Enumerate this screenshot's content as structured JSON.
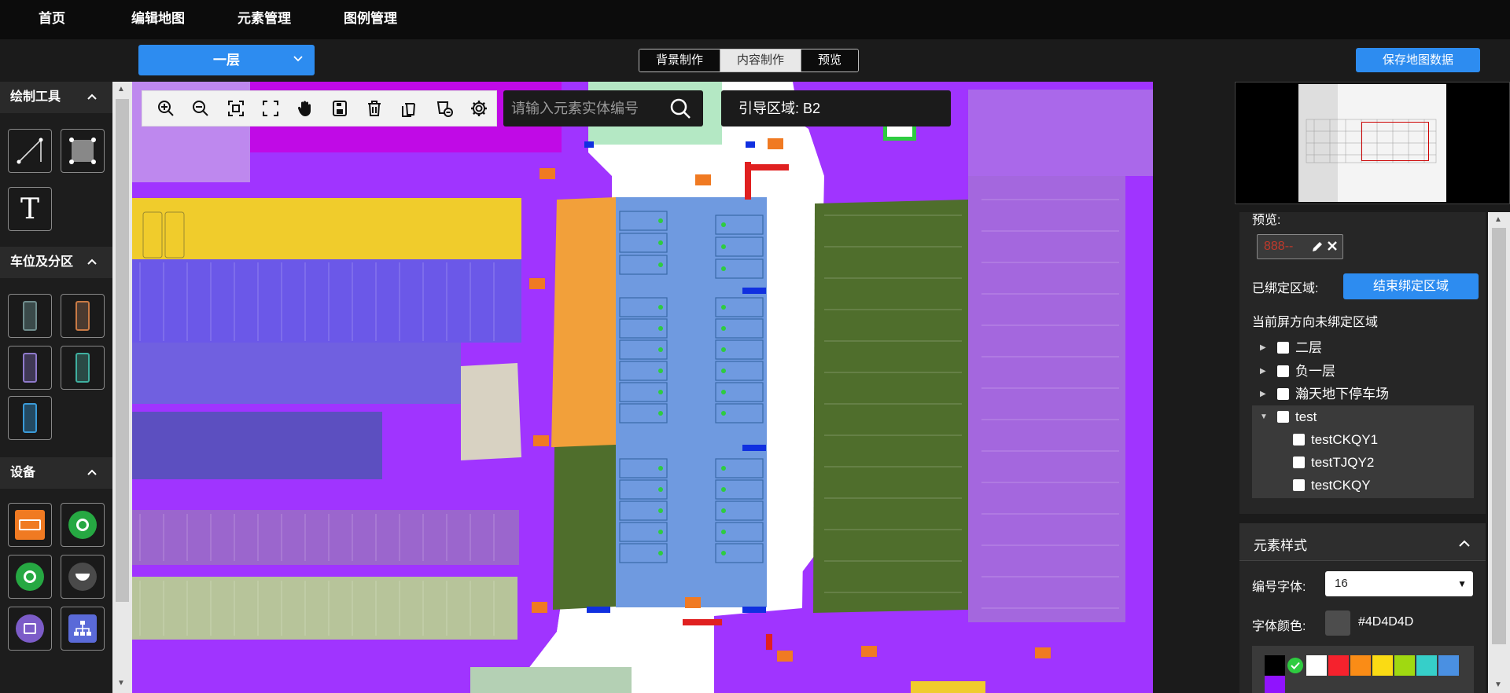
{
  "nav": {
    "items": [
      "首页",
      "编辑地图",
      "元素管理",
      "图例管理"
    ]
  },
  "toolbar": {
    "floor_selected": "一层",
    "mode_tabs": [
      "背景制作",
      "内容制作",
      "预览"
    ],
    "active_mode": "内容制作",
    "save_label": "保存地图数据"
  },
  "left_panel": {
    "draw_tools_title": "绘制工具",
    "parking_title": "车位及分区",
    "devices_title": "设备",
    "text_tool_glyph": "T"
  },
  "map": {
    "search_placeholder": "请输入元素实体编号",
    "guide_area_label": "引导区域: B2"
  },
  "right_panel": {
    "preview_label": "预览:",
    "preview_value": "888--",
    "bound_label": "已绑定区域:",
    "end_bind_button": "结束绑定区域",
    "unbound_title": "当前屏方向未绑定区域",
    "tree": [
      {
        "label": "二层",
        "expanded": false,
        "level": 0
      },
      {
        "label": "负一层",
        "expanded": false,
        "level": 0
      },
      {
        "label": "瀚天地下停车场",
        "expanded": false,
        "level": 0
      },
      {
        "label": "test",
        "expanded": true,
        "level": 0
      },
      {
        "label": "testCKQY1",
        "level": 1
      },
      {
        "label": "testTJQY2",
        "level": 1
      },
      {
        "label": "testCKQY",
        "level": 1
      }
    ],
    "style_section_title": "元素样式",
    "font_size_label": "编号字体:",
    "font_size_value": "16",
    "font_color_label": "字体颜色:",
    "font_color_value": "#4D4D4D",
    "palette": [
      "#000000",
      "#ffffff",
      "#f5222d",
      "#fa8c16",
      "#fadb14",
      "#a0d911",
      "#36cfc9",
      "#4a90e2",
      "#9013fe"
    ]
  },
  "colors": {
    "accent": "#2d8cf0",
    "map_purple": "#a034ff",
    "zone_yellow": "#f0cc2c",
    "zone_blue": "#6f9ae0",
    "zone_green": "#4f6e2c",
    "zone_orange": "#f2a03a"
  }
}
